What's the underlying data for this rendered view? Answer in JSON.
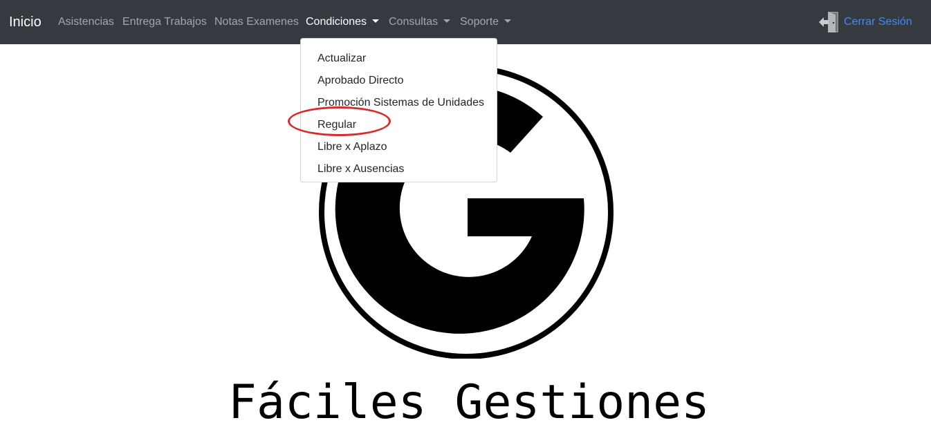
{
  "navbar": {
    "brand": "Inicio",
    "links": [
      {
        "label": "Asistencias"
      },
      {
        "label": "Entrega Trabajos"
      },
      {
        "label": "Notas Examenes"
      }
    ],
    "dropdowns": [
      {
        "label": "Condiciones",
        "expanded": true
      },
      {
        "label": "Consultas",
        "expanded": false
      },
      {
        "label": "Soporte",
        "expanded": false
      }
    ],
    "logout": {
      "label": "Cerrar Sesión",
      "icon": "door-exit-icon"
    }
  },
  "condiciones_menu": {
    "items": [
      {
        "label": "Actualizar"
      },
      {
        "label": "Aprobado Directo"
      },
      {
        "label": "Promoción Sistemas de Unidades"
      },
      {
        "label": "Regular",
        "annotated": true
      },
      {
        "label": "Libre x Aplazo"
      },
      {
        "label": "Libre x Ausencias"
      }
    ]
  },
  "main": {
    "logo_icon": "g-logo",
    "title": "Fáciles Gestiones"
  },
  "colors": {
    "navbar_bg": "#343a40",
    "link_muted": "rgba(255,255,255,0.55)",
    "link_active": "#ffffff",
    "logout_link": "#3d8bfd",
    "annotation_ring": "#d62d2d"
  }
}
